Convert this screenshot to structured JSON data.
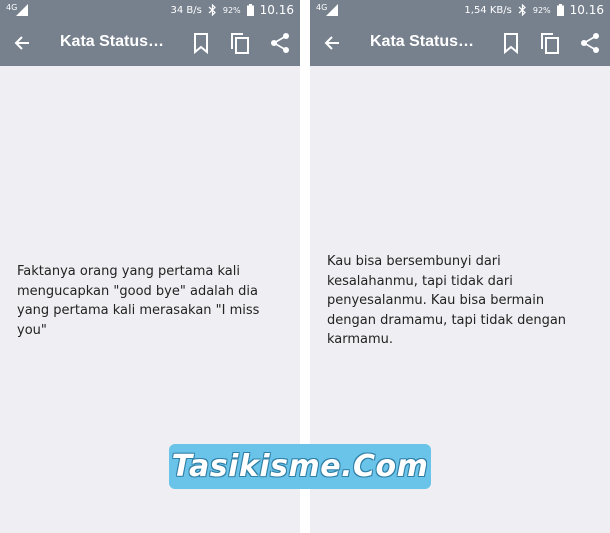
{
  "screens": [
    {
      "status_bar": {
        "network": "4G",
        "speed": "34 B/s",
        "battery_percent": "92%",
        "time": "10.16"
      },
      "app_bar": {
        "title": "Kata Status…",
        "icons": [
          "back-arrow-icon",
          "bookmark-icon",
          "copy-icon",
          "share-icon"
        ]
      },
      "quote": "Faktanya orang yang pertama kali mengucapkan \"good bye\" adalah dia yang pertama kali merasakan \"I miss you\""
    },
    {
      "status_bar": {
        "network": "4G",
        "speed": "1,54 KB/s",
        "battery_percent": "92%",
        "time": "10.16"
      },
      "app_bar": {
        "title": "Kata Status…",
        "icons": [
          "back-arrow-icon",
          "bookmark-icon",
          "copy-icon",
          "share-icon"
        ]
      },
      "quote": "Kau bisa bersembunyi dari kesalahanmu, tapi tidak dari penyesalanmu. Kau bisa bermain dengan dramamu, tapi tidak dengan karmamu."
    }
  ],
  "watermark": {
    "text": "Tasikisme.Com"
  },
  "colors": {
    "bar": "#77818e",
    "background": "#efeff3",
    "text": "#222222",
    "watermark_bg": "#6ac3e8"
  }
}
